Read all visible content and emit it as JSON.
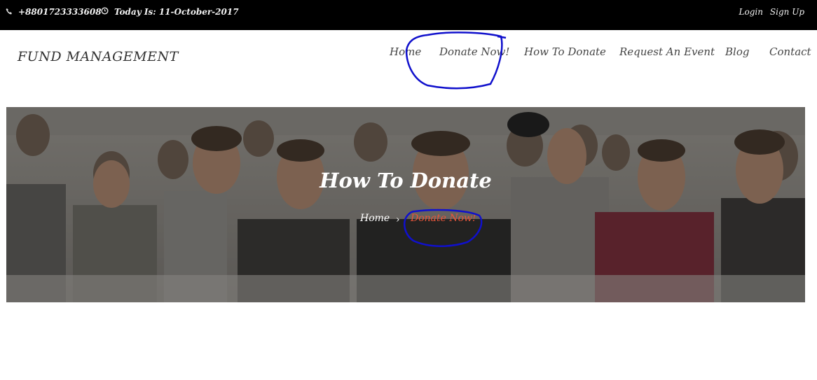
{
  "topbar": {
    "phone": "+8801723333608",
    "phone_icon": "phone-icon",
    "date": "Today Is: 11-October-2017",
    "date_icon": "clock-icon",
    "login": "Login",
    "signup": "Sign Up"
  },
  "header": {
    "brand": "FUND MANAGEMENT",
    "nav": {
      "home": "Home",
      "donate": "Donate Now!",
      "how": "How To Donate",
      "request": "Request An Event",
      "blog": "Blog",
      "contact": "Contact"
    }
  },
  "hero": {
    "title": "How To Donate",
    "breadcrumb": {
      "home": "Home",
      "separator_icon": "chevron-right-icon",
      "current": "Donate Now!"
    }
  },
  "colors": {
    "topbar_bg": "#000000",
    "accent": "#e8553a",
    "annotation": "#1010cc"
  }
}
